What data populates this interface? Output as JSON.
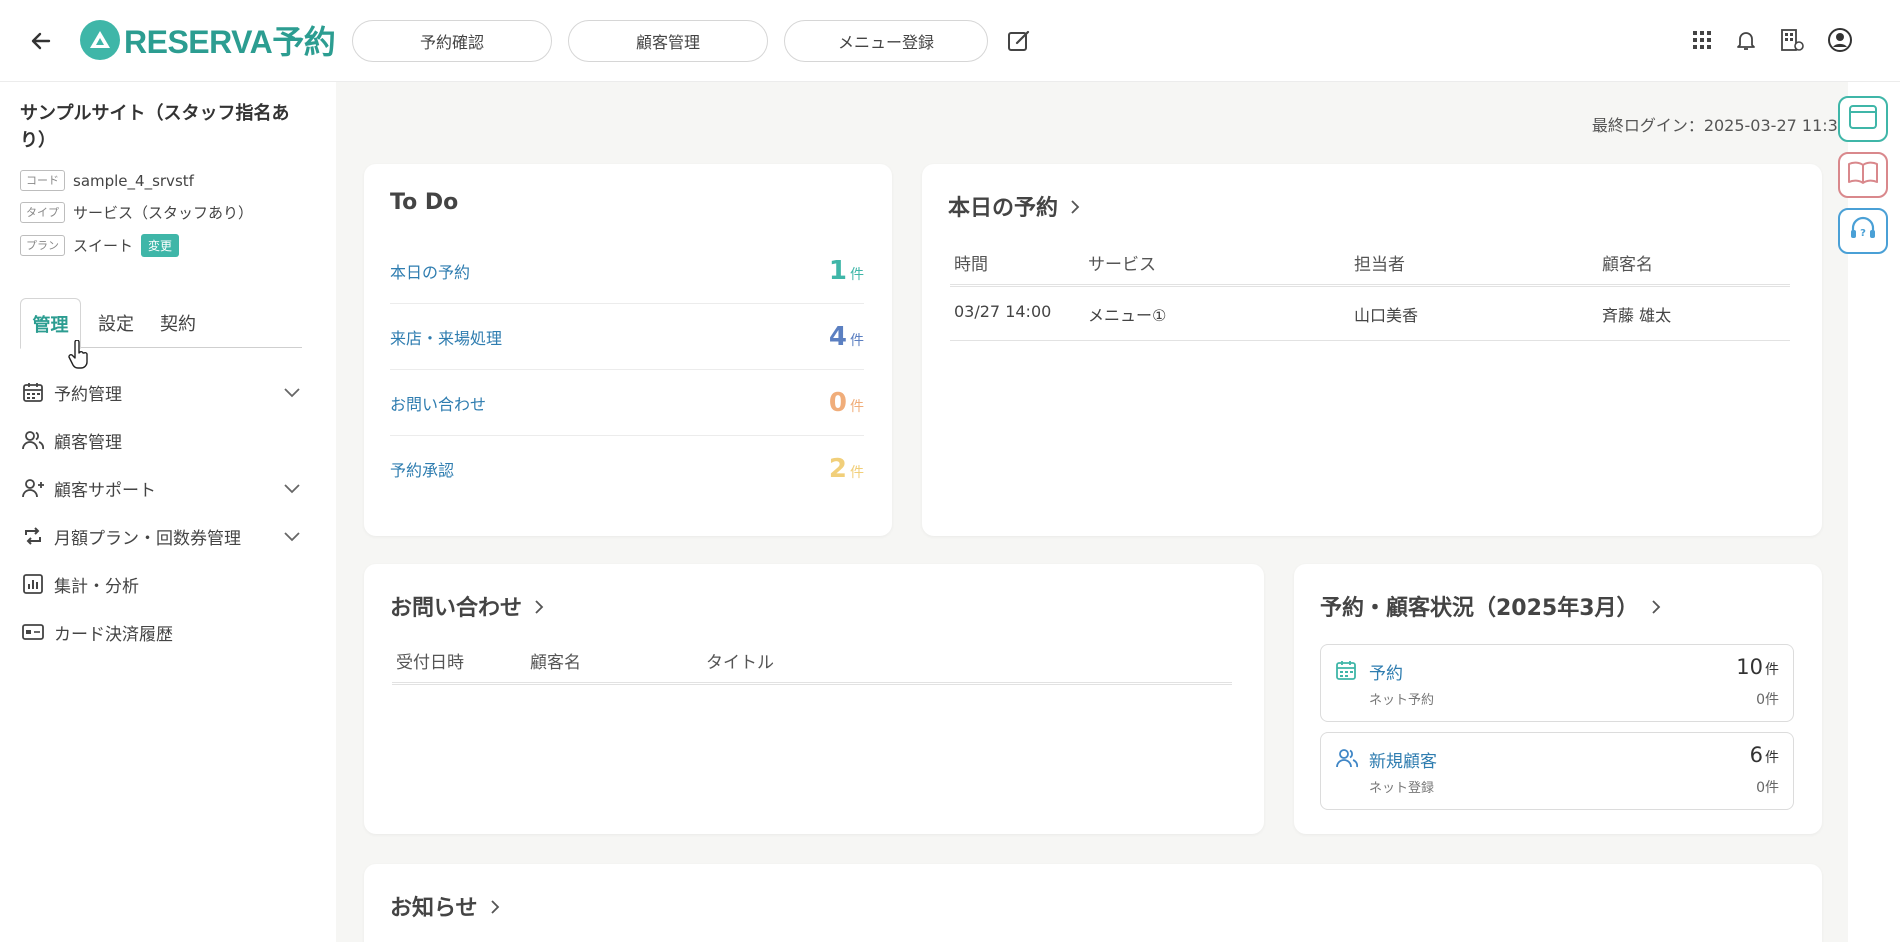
{
  "header": {
    "logo_text": "RESERVA予約",
    "nav": [
      "予約確認",
      "顧客管理",
      "メニュー登録"
    ]
  },
  "sidebar": {
    "site_title": "サンプルサイト（スタッフ指名あり）",
    "code_tag": "コード",
    "code_value": "sample_4_srvstf",
    "type_tag": "タイプ",
    "type_value": "サービス（スタッフあり）",
    "plan_tag": "プラン",
    "plan_value": "スイート",
    "change_label": "変更",
    "tabs": [
      "管理",
      "設定",
      "契約"
    ],
    "menu": [
      "予約管理",
      "顧客管理",
      "顧客サポート",
      "月額プラン・回数券管理",
      "集計・分析",
      "カード決済履歴"
    ]
  },
  "main": {
    "last_login": "最終ログイン：2025-03-27 11:32",
    "todo": {
      "title": "To Do",
      "unit": "件",
      "items": [
        {
          "label": "本日の予約",
          "count": "1",
          "color": "#3fb6a8"
        },
        {
          "label": "来店・来場処理",
          "count": "4",
          "color": "#5b7fc1"
        },
        {
          "label": "お問い合わせ",
          "count": "0",
          "color": "#f0ad7a"
        },
        {
          "label": "予約承認",
          "count": "2",
          "color": "#f1cf7a"
        }
      ]
    },
    "today": {
      "title": "本日の予約",
      "headers": [
        "時間",
        "サービス",
        "担当者",
        "顧客名"
      ],
      "rows": [
        [
          "03/27 14:00",
          "メニュー①",
          "山口美香",
          "斉藤 雄太"
        ]
      ]
    },
    "inquiry": {
      "title": "お問い合わせ",
      "headers": [
        "受付日時",
        "顧客名",
        "タイトル"
      ]
    },
    "status": {
      "title": "予約・顧客状況（2025年3月）",
      "items": [
        {
          "label": "予約",
          "sub": "ネット予約",
          "value": "10",
          "unit": "件",
          "sub_value": "0件"
        },
        {
          "label": "新規顧客",
          "sub": "ネット登録",
          "value": "6",
          "unit": "件",
          "sub_value": "0件"
        }
      ]
    },
    "news": {
      "title": "お知らせ"
    }
  },
  "colors": {
    "accent": "#3fb6a8",
    "link": "#2f7db0",
    "tool_browser": "#3fb6a8",
    "tool_book": "#d9888c",
    "tool_support": "#4aa0d6"
  }
}
